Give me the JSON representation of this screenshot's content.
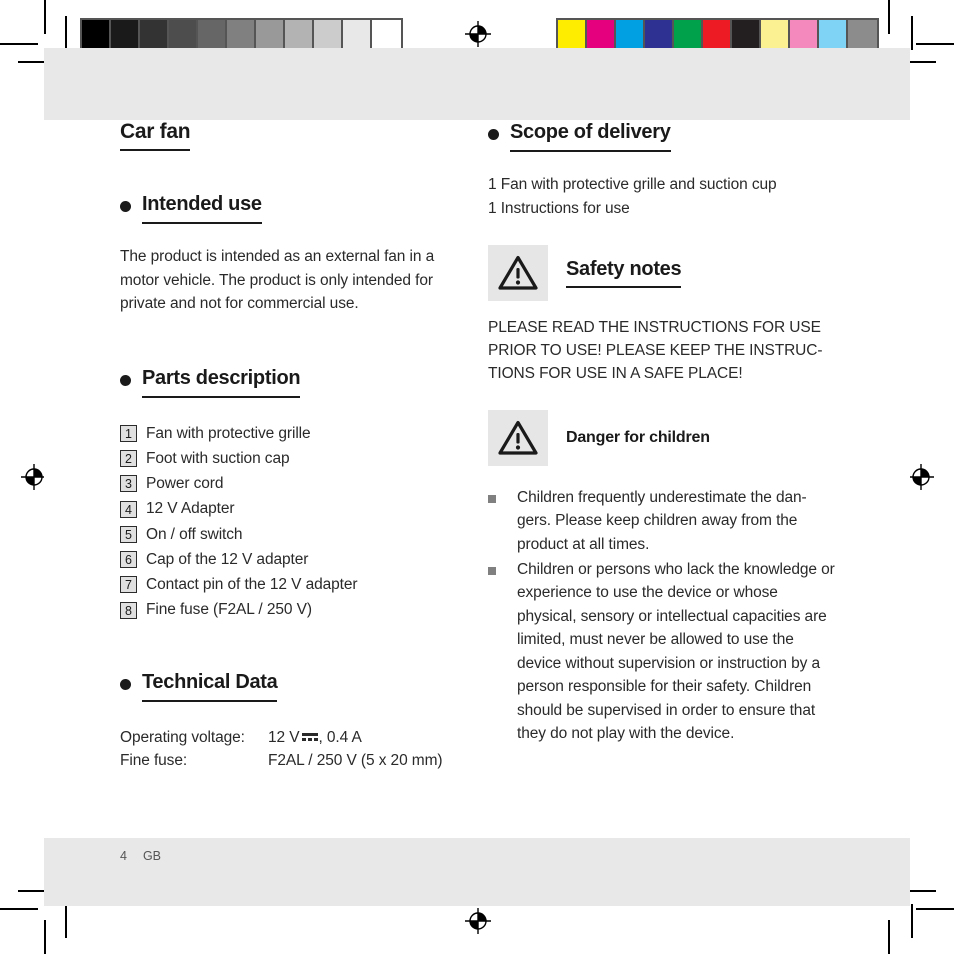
{
  "document": {
    "title": "Car fan",
    "footer": {
      "page_number": "4",
      "language_code": "GB"
    }
  },
  "calibration": {
    "grayscale_label": "grayscale-calibration-strip",
    "grayscale_swatches": [
      "#000000",
      "#1a1a1a",
      "#333333",
      "#4d4d4d",
      "#666666",
      "#808080",
      "#999999",
      "#b3b3b3",
      "#cccccc",
      "#e8e8e8",
      "#ffffff"
    ],
    "color_label": "color-calibration-strip",
    "color_swatches": [
      "#ffed00",
      "#e5007d",
      "#00a0e3",
      "#2e3192",
      "#00a14b",
      "#ed1c24",
      "#231f20",
      "#fbf193",
      "#f489bd",
      "#7fd4f5",
      "#8c8c8c"
    ]
  },
  "left_column": {
    "intended_use": {
      "heading": "Intended use",
      "body": "The product is intended as an external fan in a motor vehicle. The product is only intended for private and not for commercial use."
    },
    "parts_description": {
      "heading": "Parts description",
      "items": [
        {
          "number": "1",
          "label": "Fan with protective grille"
        },
        {
          "number": "2",
          "label": "Foot with suction cap"
        },
        {
          "number": "3",
          "label": "Power cord"
        },
        {
          "number": "4",
          "label": "12 V Adapter"
        },
        {
          "number": "5",
          "label": "On / off switch"
        },
        {
          "number": "6",
          "label": "Cap of the 12 V adapter"
        },
        {
          "number": "7",
          "label": "Contact pin of the 12 V adapter"
        },
        {
          "number": "8",
          "label": "Fine fuse (F2AL / 250 V)"
        }
      ]
    },
    "technical_data": {
      "heading": "Technical Data",
      "rows": [
        {
          "key": "Operating voltage:",
          "value_prefix": "12 V",
          "value_suffix": ", 0.4 A",
          "has_dc_symbol": true
        },
        {
          "key": "Fine fuse:",
          "value_prefix": "F2AL / 250 V (5 x 20 mm)",
          "value_suffix": "",
          "has_dc_symbol": false
        }
      ]
    }
  },
  "right_column": {
    "scope_of_delivery": {
      "heading": "Scope of delivery",
      "lines": [
        "1 Fan with protective grille and suction cup",
        "1 Instructions for use"
      ]
    },
    "safety_notes": {
      "heading": "Safety notes",
      "warning_icon": "warning-triangle-icon",
      "body": "PLEASE READ THE INSTRUCTIONS FOR USE PRIOR TO USE! PLEASE KEEP THE INSTRUC-TIONS FOR USE IN A SAFE PLACE!"
    },
    "danger_for_children": {
      "heading": "Danger for children",
      "warning_icon": "warning-triangle-icon",
      "bullets": [
        "Children frequently underestimate the dan-gers. Please keep children away from the product at all times.",
        "Children or persons who lack the knowledge or experience to use the device or whose physical, sensory or intellectual capacities are limited, must never be allowed to use the device without supervision or instruction by a person responsible for their safety. Children should be supervised in order to ensure that they do not play with the device."
      ]
    }
  }
}
